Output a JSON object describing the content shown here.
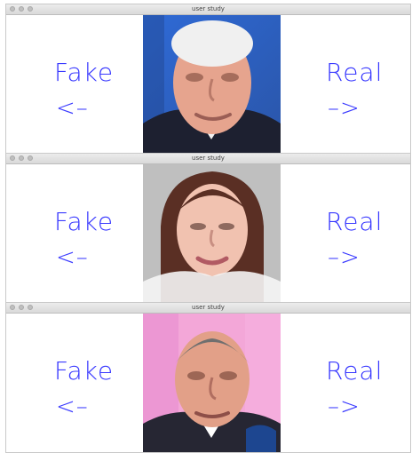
{
  "windows": [
    {
      "title": "user study",
      "left": {
        "word": "Fake",
        "arrow": "<–"
      },
      "right": {
        "word": "Real",
        "arrow": "–>"
      },
      "face": "face-photo-older-man-blue-background"
    },
    {
      "title": "user study",
      "left": {
        "word": "Fake",
        "arrow": "<–"
      },
      "right": {
        "word": "Real",
        "arrow": "–>"
      },
      "face": "face-photo-woman-long-brown-hair"
    },
    {
      "title": "user study",
      "left": {
        "word": "Fake",
        "arrow": "<–"
      },
      "right": {
        "word": "Real",
        "arrow": "–>"
      },
      "face": "face-photo-man-pink-background"
    }
  ],
  "colors": {
    "label": "#3a3aff",
    "titlebar_top": "#ececec",
    "titlebar_bottom": "#d9d9d9"
  }
}
